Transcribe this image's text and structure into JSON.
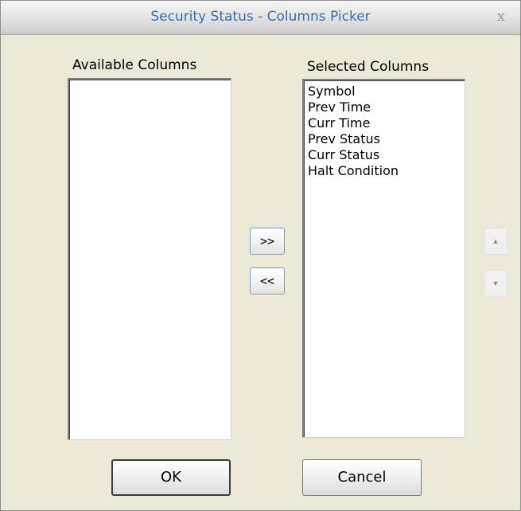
{
  "window": {
    "title": "Security Status - Columns Picker",
    "close_glyph": "x"
  },
  "available": {
    "label": "Available Columns",
    "items": []
  },
  "selected": {
    "label": "Selected Columns",
    "items": [
      "Symbol",
      "Prev Time",
      "Curr Time",
      "Prev Status",
      "Curr Status",
      "Halt Condition"
    ]
  },
  "transfer": {
    "add_label": ">>",
    "remove_label": "<<"
  },
  "order": {
    "up_icon": "up-arrow-icon",
    "down_icon": "down-arrow-icon"
  },
  "buttons": {
    "ok_label": "OK",
    "cancel_label": "Cancel"
  }
}
